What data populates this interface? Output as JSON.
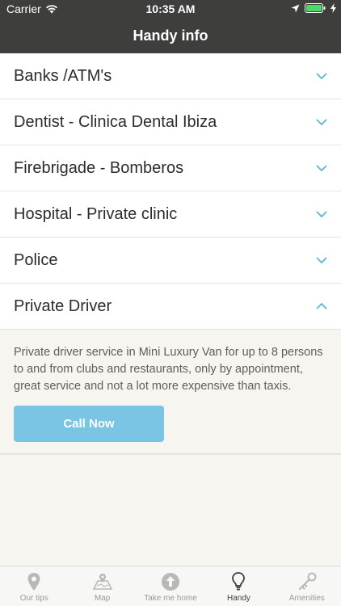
{
  "status_bar": {
    "carrier": "Carrier",
    "time": "10:35 AM"
  },
  "header": {
    "title": "Handy info"
  },
  "rows": [
    {
      "label": "Banks /ATM's",
      "expanded": false
    },
    {
      "label": "Dentist - Clinica Dental Ibiza",
      "expanded": false
    },
    {
      "label": "Firebrigade - Bomberos",
      "expanded": false
    },
    {
      "label": "Hospital - Private clinic",
      "expanded": false
    },
    {
      "label": "Police",
      "expanded": false
    },
    {
      "label": "Private Driver",
      "expanded": true
    }
  ],
  "expanded_detail": {
    "description": "Private driver service in Mini Luxury Van for up to 8 persons to and from clubs and restaurants, only by appointment, great service and not a lot more expensive than taxis.",
    "button_label": "Call Now"
  },
  "tabs": [
    {
      "label": "Our tips",
      "icon": "location-pin-icon",
      "active": false
    },
    {
      "label": "Map",
      "icon": "map-icon",
      "active": false
    },
    {
      "label": "Take me home",
      "icon": "arrow-up-circle-icon",
      "active": false
    },
    {
      "label": "Handy",
      "icon": "lightbulb-icon",
      "active": true
    },
    {
      "label": "Amenities",
      "icon": "key-icon",
      "active": false
    }
  ],
  "colors": {
    "header_bg": "#3e3e3c",
    "accent": "#79c5e3",
    "chevron": "#5bb4dc"
  }
}
